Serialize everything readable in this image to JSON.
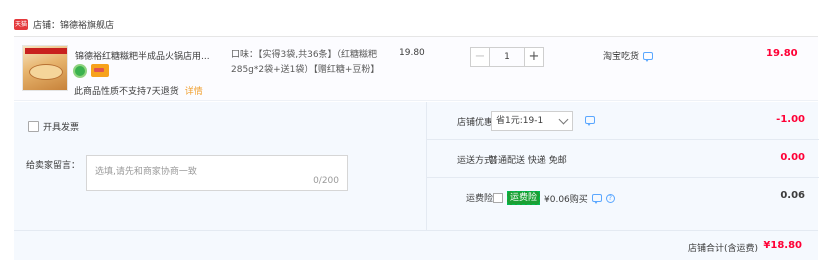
{
  "shop": {
    "logo_text": "天猫",
    "label": "店铺：锦德裕旗舰店"
  },
  "item": {
    "title": "锦德裕红糖糍粑半成品火锅店用...",
    "sku": "口味：【实得3袋,共36条】（红糖糍粑285g*2袋+送1袋）【赠红糖+豆粉】",
    "note": "此商品性质不支持7天退货",
    "note_link": "详情",
    "price": "19.80",
    "quantity": "1",
    "qty_minus": "−",
    "qty_plus": "+",
    "delivery": "淘宝吃货",
    "subtotal": "19.80"
  },
  "options": {
    "invoice_label": "开具发票",
    "message_label": "给卖家留言：",
    "message_placeholder": "选填,请先和商家协商一致",
    "message_count": "0/200",
    "coupon": {
      "label": "店铺优惠：",
      "selected": "省1元:19-1",
      "amount": "-1.00"
    },
    "shipping": {
      "label": "运送方式：",
      "value": "普通配送 快递 免邮",
      "amount": "0.00"
    },
    "insurance": {
      "label": "运费险：",
      "tag": "运费险",
      "value": "¥0.06购买",
      "help": "?",
      "amount": "0.06"
    }
  },
  "total": {
    "label": "店铺合计(含运费)",
    "value": "¥18.80"
  },
  "colors": {
    "price_red": "#ff0036",
    "tmall_red": "#e4393c",
    "link_orange": "#f0a030",
    "panel_bg": "#f5f9fe"
  },
  "icons": [
    "tmall-logo-icon",
    "green-badge-icon",
    "card-badge-icon",
    "chat-icon",
    "chevron-down-icon",
    "help-icon"
  ]
}
